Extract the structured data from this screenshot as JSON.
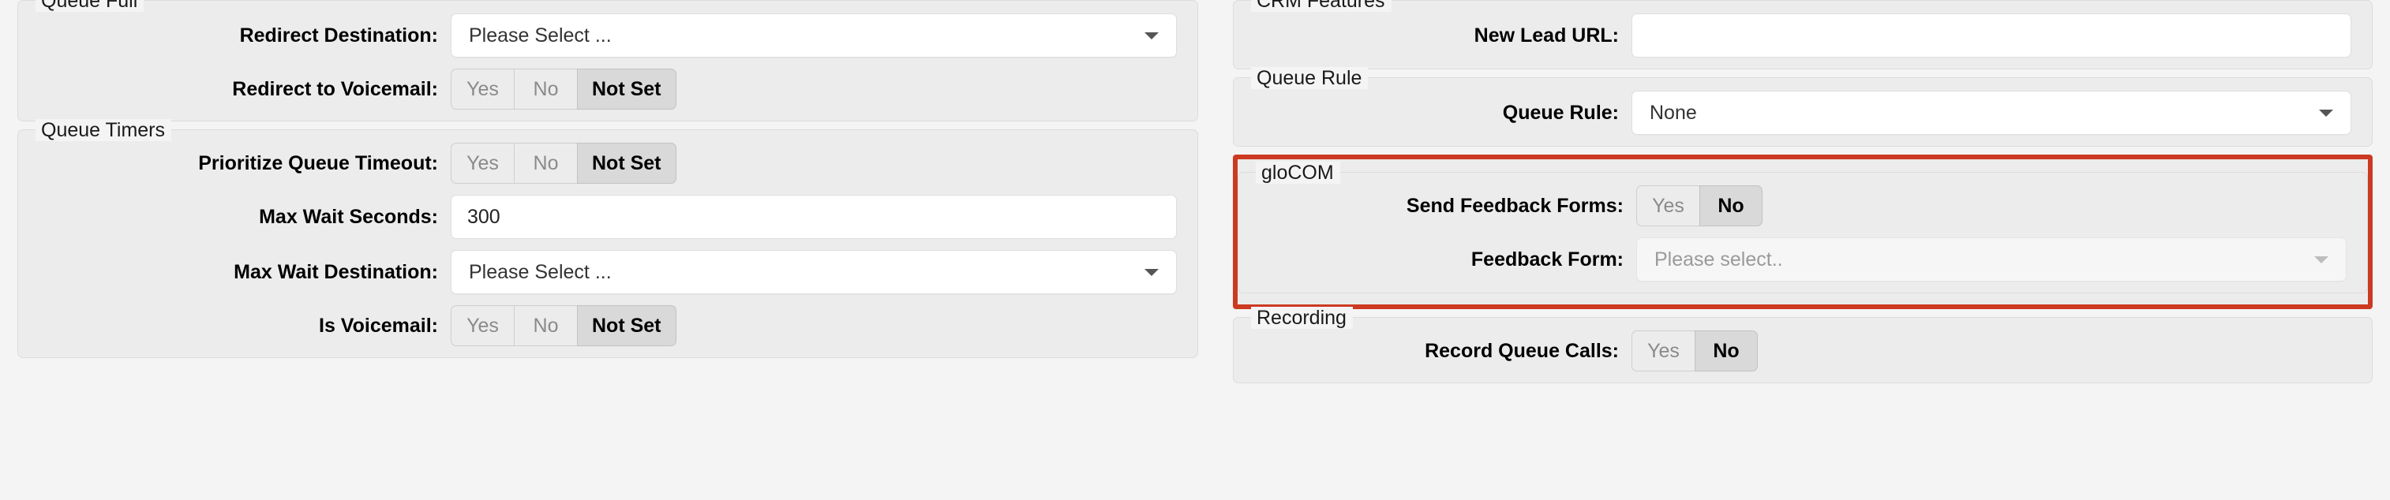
{
  "colors": {
    "highlight_border": "#cc3a21",
    "page_background": "#f4f4f4",
    "panel_background": "#ececec",
    "field_background": "#ffffff",
    "active_button_background": "#d9d9d9"
  },
  "left_column": {
    "panels": [
      {
        "legend": "Queue Full",
        "rows": [
          {
            "label": "Redirect Destination:",
            "type": "select",
            "value": "Please Select ...",
            "disabled": false
          },
          {
            "label": "Redirect to Voicemail:",
            "type": "buttons",
            "options": [
              "Yes",
              "No",
              "Not Set"
            ],
            "selected": "Not Set"
          }
        ]
      },
      {
        "legend": "Queue Timers",
        "rows": [
          {
            "label": "Prioritize Queue Timeout:",
            "type": "buttons",
            "options": [
              "Yes",
              "No",
              "Not Set"
            ],
            "selected": "Not Set"
          },
          {
            "label": "Max Wait Seconds:",
            "type": "text",
            "value": "300",
            "placeholder": ""
          },
          {
            "label": "Max Wait Destination:",
            "type": "select",
            "value": "Please Select ...",
            "disabled": false
          },
          {
            "label": "Is Voicemail:",
            "type": "buttons",
            "options": [
              "Yes",
              "No",
              "Not Set"
            ],
            "selected": "Not Set"
          }
        ]
      }
    ]
  },
  "right_column": {
    "panels": [
      {
        "legend": "CRM Features",
        "highlighted": false,
        "rows": [
          {
            "label": "New Lead URL:",
            "type": "text",
            "value": "",
            "placeholder": ""
          }
        ]
      },
      {
        "legend": "Queue Rule",
        "highlighted": false,
        "rows": [
          {
            "label": "Queue Rule:",
            "type": "select",
            "value": "None",
            "disabled": false
          }
        ]
      },
      {
        "legend": "gloCOM",
        "highlighted": true,
        "rows": [
          {
            "label": "Send Feedback Forms:",
            "type": "buttons",
            "options": [
              "Yes",
              "No"
            ],
            "selected": "No"
          },
          {
            "label": "Feedback Form:",
            "type": "select",
            "value": "Please select..",
            "disabled": true
          }
        ]
      },
      {
        "legend": "Recording",
        "highlighted": false,
        "rows": [
          {
            "label": "Record Queue Calls:",
            "type": "buttons",
            "options": [
              "Yes",
              "No"
            ],
            "selected": "No"
          }
        ]
      }
    ]
  }
}
